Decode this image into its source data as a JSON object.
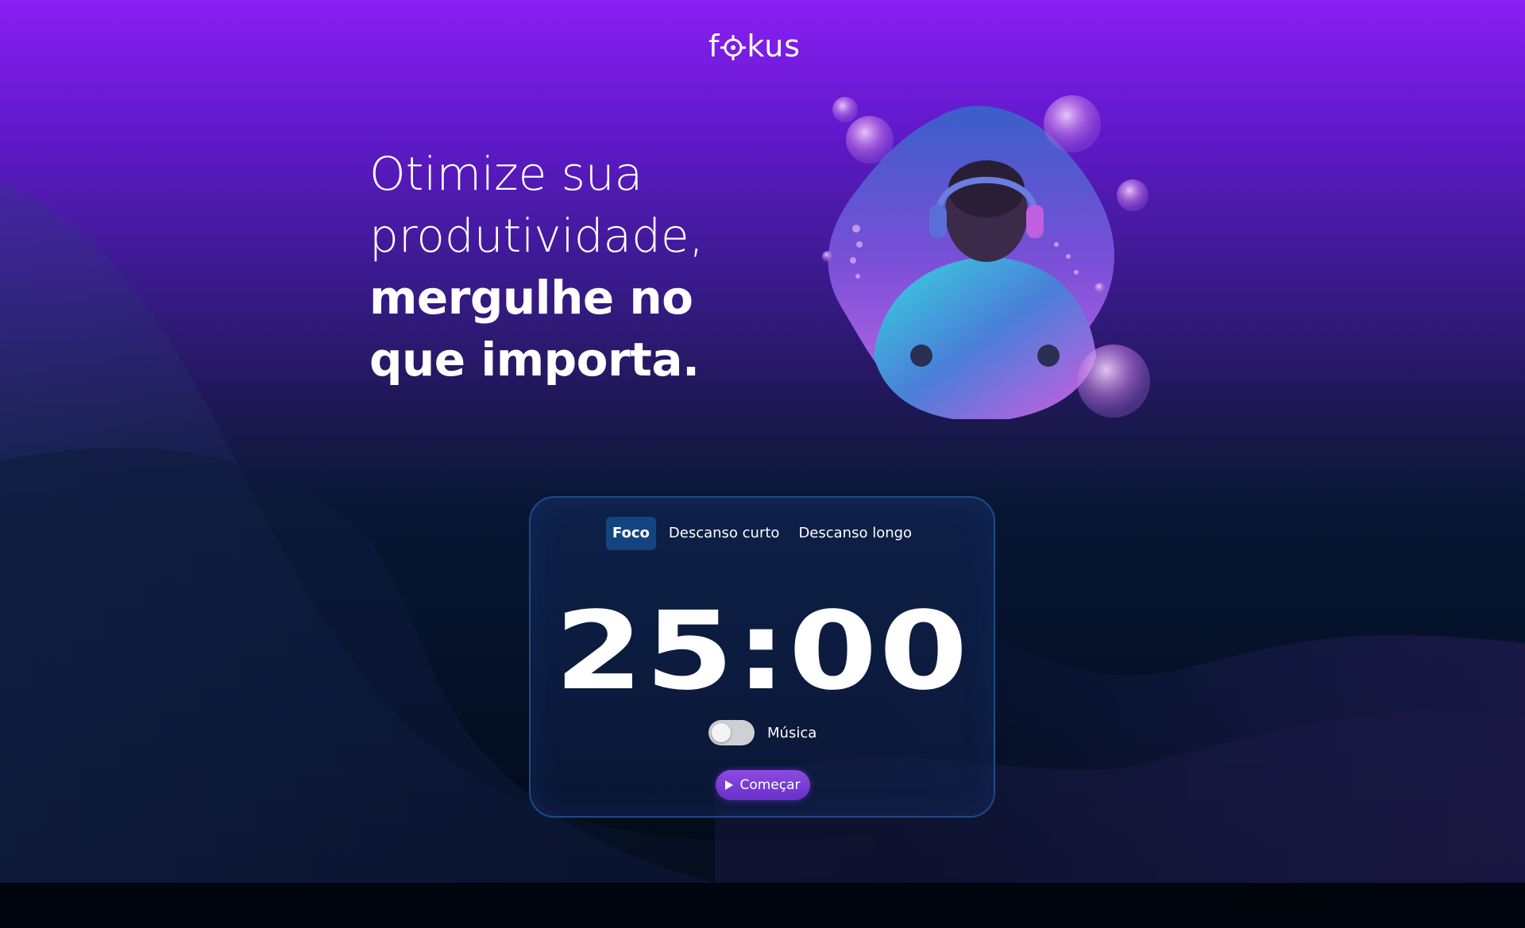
{
  "app": {
    "logo_text_left": "f",
    "logo_text_right": "kus"
  },
  "hero": {
    "line1": "Otimize sua",
    "line2": "produtividade,",
    "line3": "mergulhe no",
    "line4": "que importa."
  },
  "timer_card": {
    "tabs": [
      {
        "label": "Foco",
        "active": true
      },
      {
        "label": "Descanso curto",
        "active": false
      },
      {
        "label": "Descanso longo",
        "active": false
      }
    ],
    "time": "25:00",
    "music_label": "Música",
    "music_enabled": false,
    "start_label": "Começar"
  },
  "colors": {
    "accent_purple": "#8a4be0",
    "active_tab": "#144480",
    "card_border": "#1e4a8a"
  },
  "icons": {
    "start": "play-icon",
    "logo": "target-icon"
  }
}
